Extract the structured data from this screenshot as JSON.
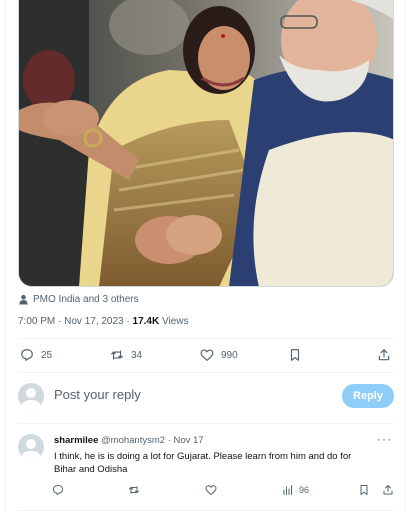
{
  "tweet": {
    "tagged_text": "PMO India and 3 others",
    "time": "7:00 PM · Nov 17, 2023",
    "separator": " · ",
    "views_count": "17.4K",
    "views_label": "Views"
  },
  "actions": {
    "replies": "25",
    "retweets": "34",
    "likes": "990"
  },
  "composer": {
    "placeholder": "Post your reply",
    "button": "Reply"
  },
  "reply": {
    "name": "sharmilee",
    "handle": "@mohantysm2",
    "date": "· Nov 17",
    "text": "I think, he is is doing a lot for Gujarat. Please learn from him and do for Bihar and Odisha",
    "views": "96",
    "more": "···"
  },
  "colors": {
    "secondary_text": "#536471",
    "reply_button": "#8ecdf8",
    "divider": "#eff3f4"
  },
  "icons": [
    "person-icon",
    "reply-icon",
    "retweet-icon",
    "like-icon",
    "bookmark-icon",
    "share-icon",
    "views-icon",
    "more-icon"
  ]
}
